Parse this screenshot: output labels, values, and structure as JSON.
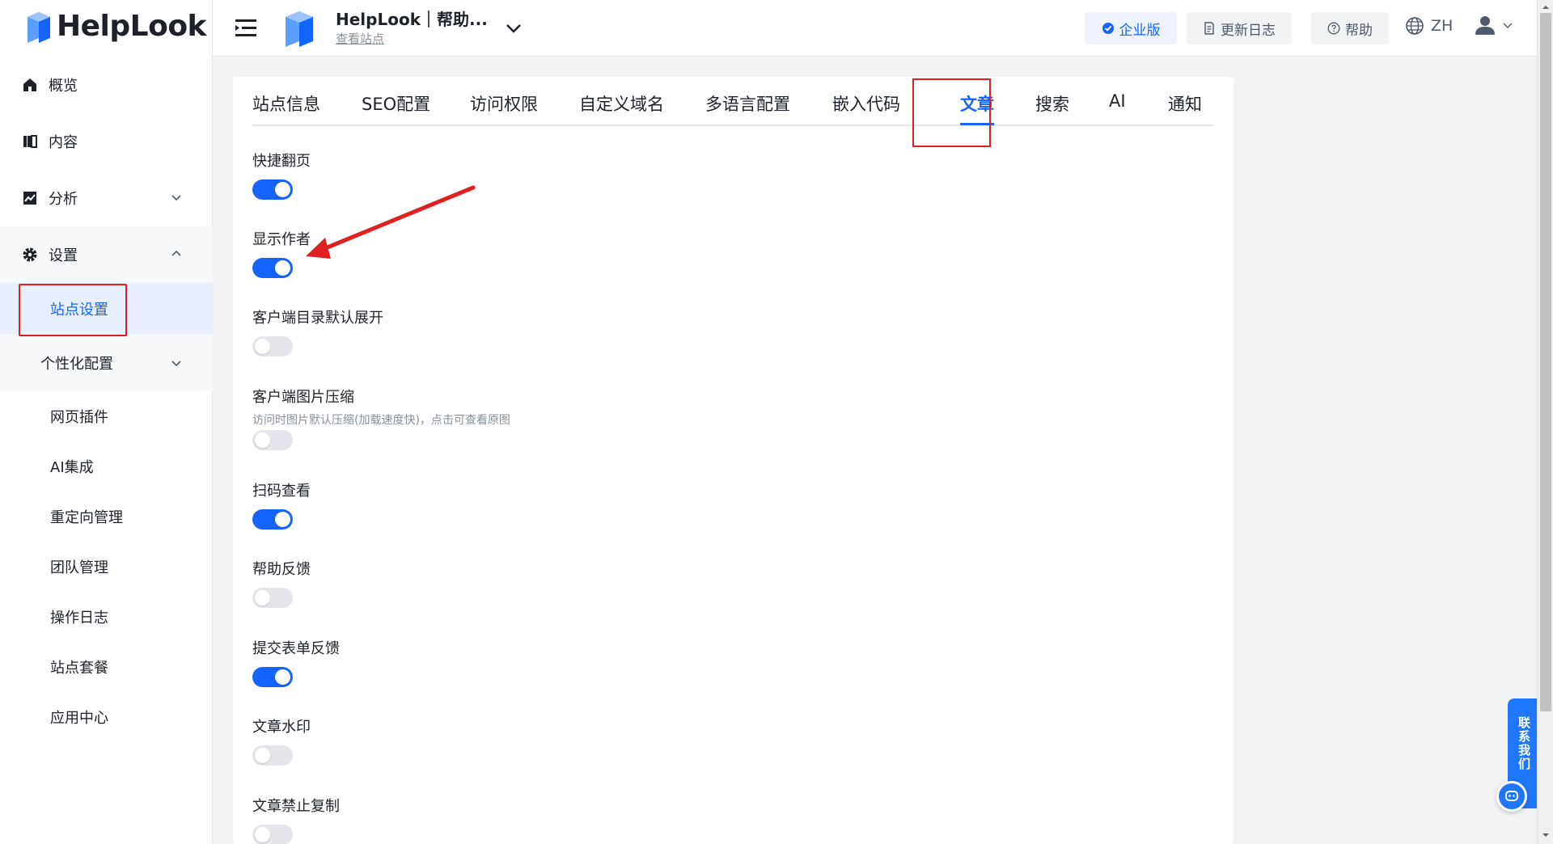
{
  "brand": {
    "name": "HelpLook"
  },
  "sidebar": {
    "items": [
      {
        "label": "概览",
        "icon": "home-icon"
      },
      {
        "label": "内容",
        "icon": "book-icon"
      },
      {
        "label": "分析",
        "icon": "chart-icon"
      },
      {
        "label": "设置",
        "icon": "gear-icon"
      }
    ],
    "settings_children": {
      "active": "站点设置",
      "group": "个性化配置",
      "leaves": [
        "网页插件",
        "AI集成",
        "重定向管理",
        "团队管理",
        "操作日志",
        "站点套餐",
        "应用中心"
      ]
    }
  },
  "header": {
    "site_name": "HelpLook｜帮助...",
    "site_link": "查看站点",
    "enterprise_label": "企业版",
    "changelog_label": "更新日志",
    "help_label": "帮助",
    "lang_label": "ZH"
  },
  "tabs": [
    "站点信息",
    "SEO配置",
    "访问权限",
    "自定义域名",
    "多语言配置",
    "嵌入代码",
    "文章",
    "搜索",
    "AI",
    "通知"
  ],
  "active_tab": "文章",
  "settings": [
    {
      "label": "快捷翻页",
      "on": true
    },
    {
      "label": "显示作者",
      "on": true
    },
    {
      "label": "客户端目录默认展开",
      "on": false
    },
    {
      "label": "客户端图片压缩",
      "description": "访问时图片默认压缩(加载速度快)，点击可查看原图",
      "on": false
    },
    {
      "label": "扫码查看",
      "on": true
    },
    {
      "label": "帮助反馈",
      "on": false
    },
    {
      "label": "提交表单反馈",
      "on": true
    },
    {
      "label": "文章水印",
      "on": false
    },
    {
      "label": "文章禁止复制",
      "on": false
    }
  ],
  "contact": {
    "label": "联系我们"
  },
  "colors": {
    "accent": "#1664ff",
    "annotation": "#e02020"
  }
}
